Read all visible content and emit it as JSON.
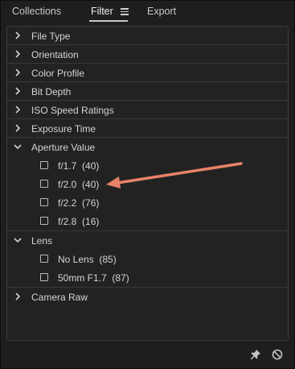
{
  "tabs": {
    "collections": "Collections",
    "filter": "Filter",
    "export": "Export"
  },
  "sections": [
    {
      "label": "File Type",
      "expanded": false
    },
    {
      "label": "Orientation",
      "expanded": false
    },
    {
      "label": "Color Profile",
      "expanded": false
    },
    {
      "label": "Bit Depth",
      "expanded": false
    },
    {
      "label": "ISO Speed Ratings",
      "expanded": false
    },
    {
      "label": "Exposure Time",
      "expanded": false
    },
    {
      "label": "Aperture Value",
      "expanded": true,
      "items": [
        {
          "label": "f/1.7  (40)",
          "checked": false
        },
        {
          "label": "f/2.0  (40)",
          "checked": false
        },
        {
          "label": "f/2.2  (76)",
          "checked": false
        },
        {
          "label": "f/2.8  (16)",
          "checked": false
        }
      ]
    },
    {
      "label": "Lens",
      "expanded": true,
      "items": [
        {
          "label": "No Lens  (85)",
          "checked": false
        },
        {
          "label": "50mm F1.7  (87)",
          "checked": false
        }
      ]
    },
    {
      "label": "Camera Raw",
      "expanded": false
    }
  ],
  "footer": {
    "pin_icon": "pin-icon",
    "clear_icon": "no-entry-icon"
  },
  "annotation": {
    "arrow_color": "#e8826a"
  }
}
